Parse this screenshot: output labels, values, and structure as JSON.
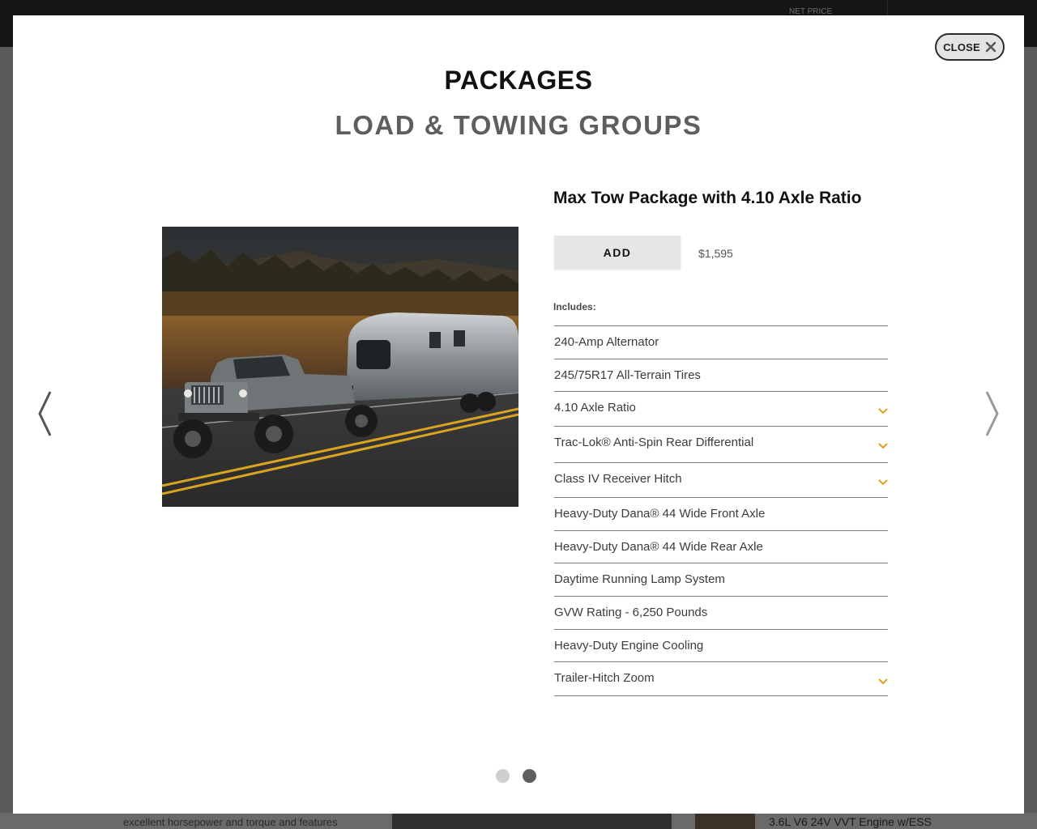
{
  "background": {
    "net_price_label": "NET PRICE",
    "left_text": "excellent horsepower and torque and features",
    "right_text": "3.6L V6 24V VVT Engine w/ESS"
  },
  "modal": {
    "close_label": "CLOSE",
    "title": "PACKAGES",
    "subtitle": "LOAD & TOWING GROUPS",
    "package": {
      "name": "Max Tow Package with 4.10 Axle Ratio",
      "add_label": "ADD",
      "price": "$1,595",
      "includes_label": "Includes:",
      "items": [
        {
          "label": "240-Amp Alternator",
          "expandable": false
        },
        {
          "label": "245/75R17 All-Terrain Tires",
          "expandable": false
        },
        {
          "label": "4.10 Axle Ratio",
          "expandable": true
        },
        {
          "label": "Trac-Lok® Anti-Spin Rear Differential",
          "expandable": true
        },
        {
          "label": "Class IV Receiver Hitch",
          "expandable": true
        },
        {
          "label": "Heavy-Duty Dana® 44 Wide Front Axle",
          "expandable": false
        },
        {
          "label": "Heavy-Duty Dana® 44 Wide Rear Axle",
          "expandable": false
        },
        {
          "label": "Daytime Running Lamp System",
          "expandable": false
        },
        {
          "label": "GVW Rating - 6,250 Pounds",
          "expandable": false
        },
        {
          "label": "Heavy-Duty Engine Cooling",
          "expandable": false
        },
        {
          "label": "Trailer-Hitch Zoom",
          "expandable": true
        }
      ]
    },
    "pagination": {
      "total": 2,
      "active_index": 1
    }
  },
  "colors": {
    "chevron_accent": "#e0a020",
    "active_dot": "#5e5e5e",
    "inactive_dot": "#cfcfcf"
  }
}
